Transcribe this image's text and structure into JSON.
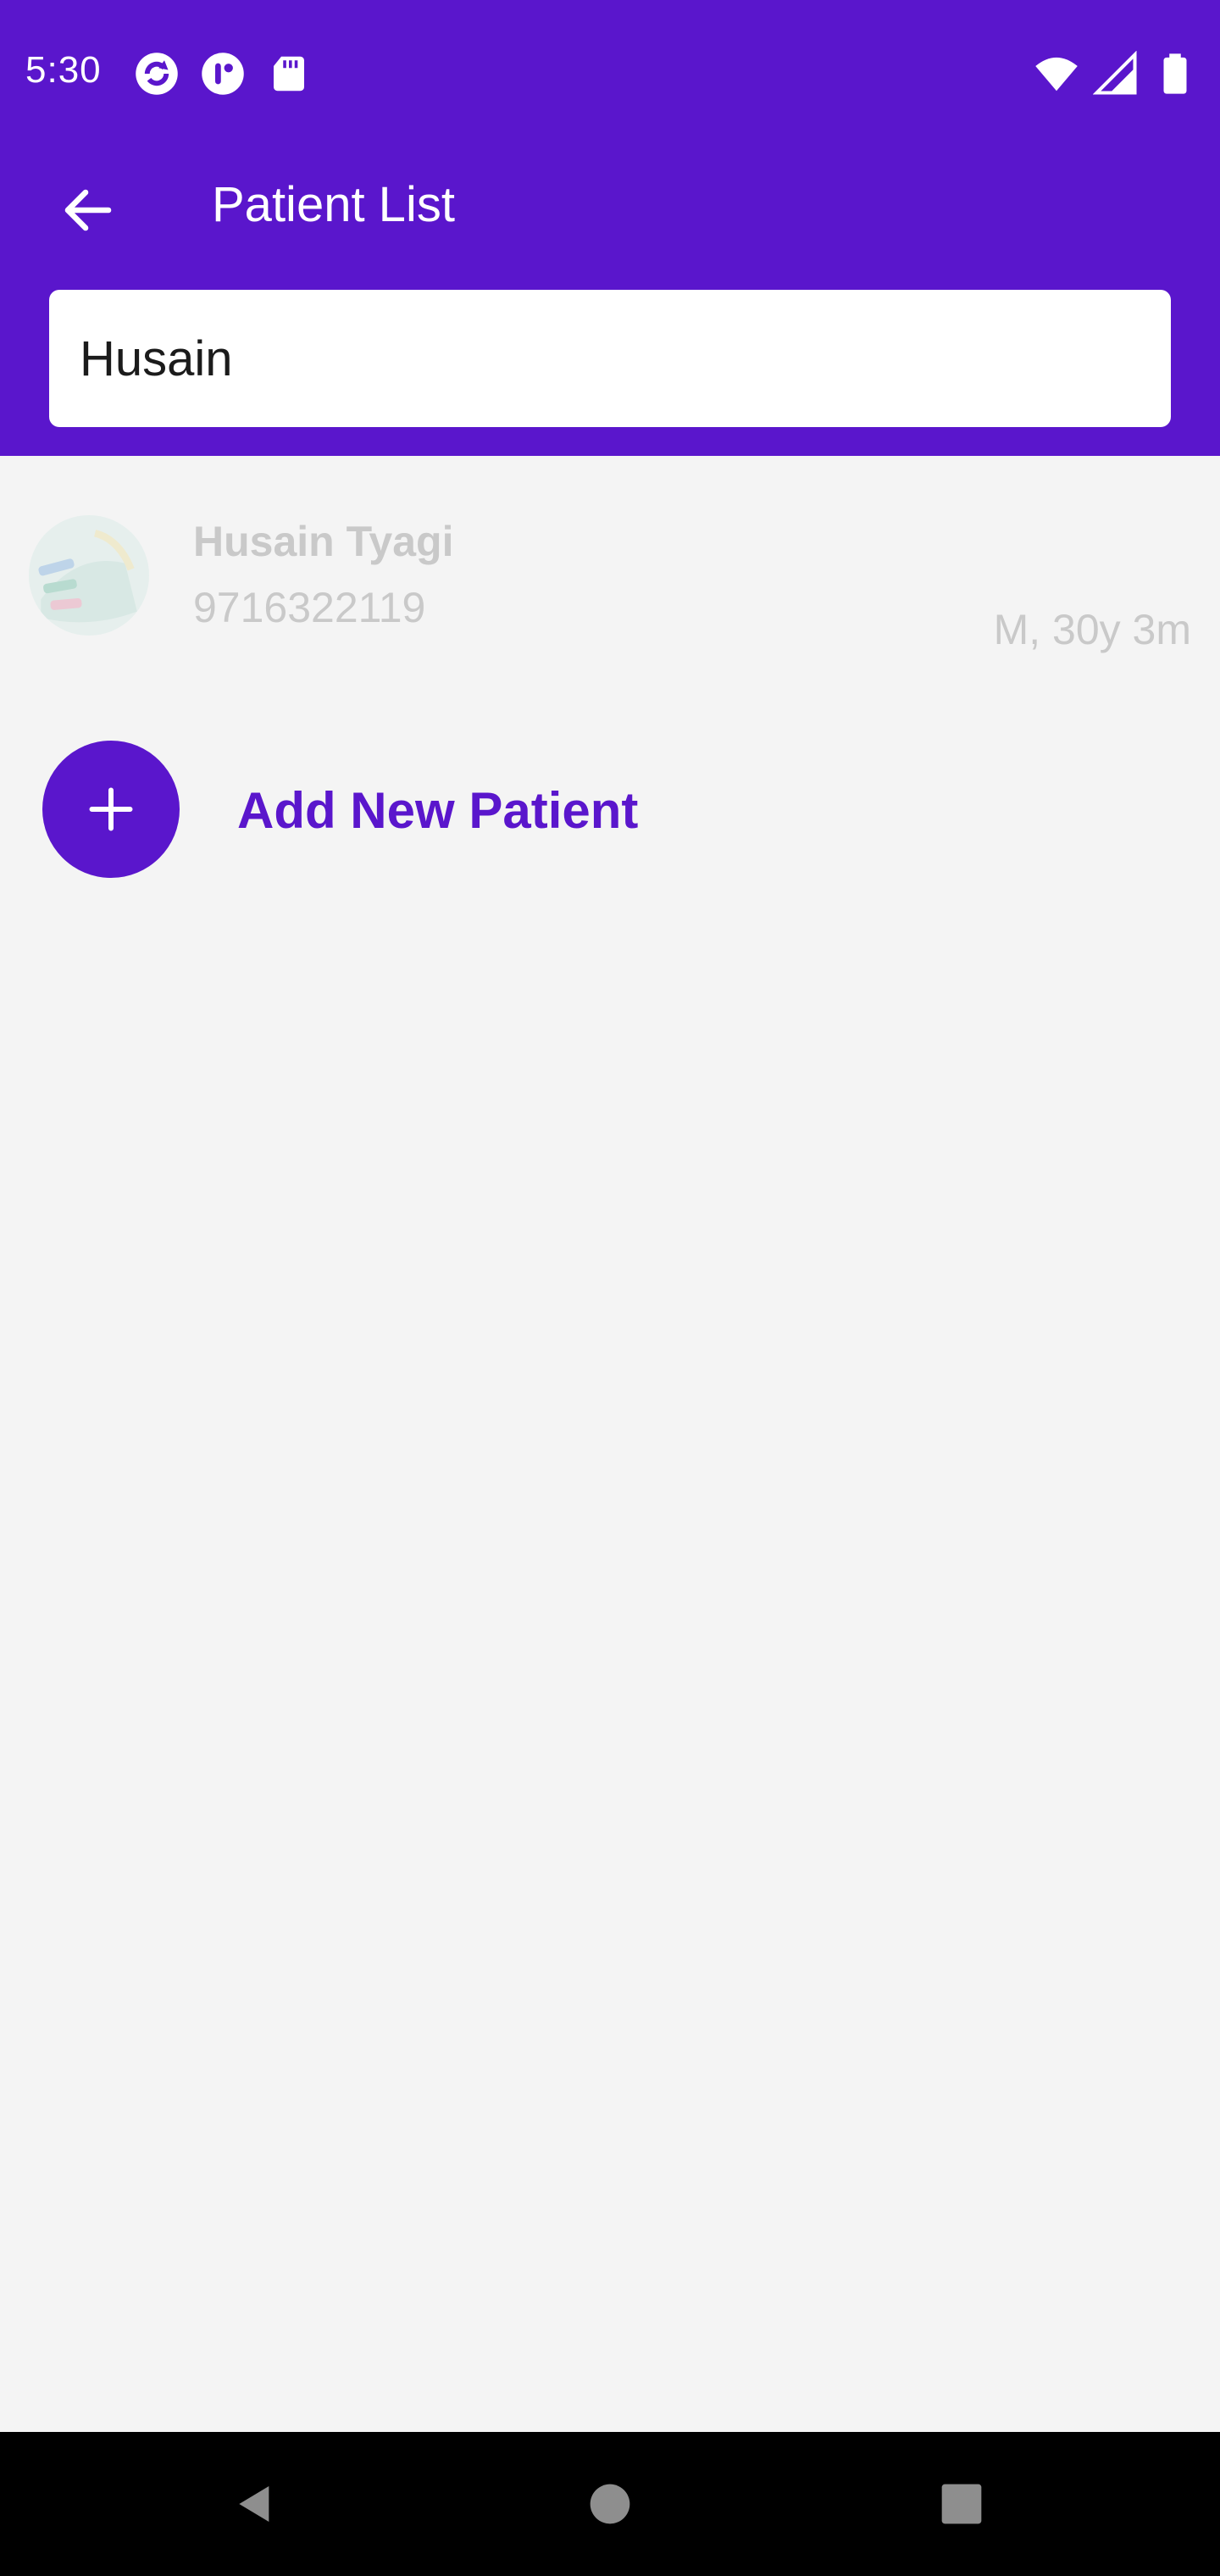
{
  "status_bar": {
    "time": "5:30",
    "left_icons": [
      "sync-app-icon",
      "app-notification-icon",
      "sd-card-icon"
    ],
    "right_icons": [
      "wifi-icon",
      "cell-signal-icon",
      "battery-icon"
    ]
  },
  "header": {
    "title": "Patient List",
    "back_icon": "arrow-left-icon",
    "background_color": "#5a16cc"
  },
  "search": {
    "value": "Husain"
  },
  "patients": [
    {
      "name": "Husain Tyagi",
      "phone": "9716322119",
      "meta": "M, 30y 3m"
    }
  ],
  "add_patient": {
    "label": "Add New Patient",
    "icon": "plus-icon",
    "accent_color": "#5a16cc"
  },
  "nav_bar": {
    "buttons": [
      "back-triangle-icon",
      "home-circle-icon",
      "recents-square-icon"
    ]
  }
}
